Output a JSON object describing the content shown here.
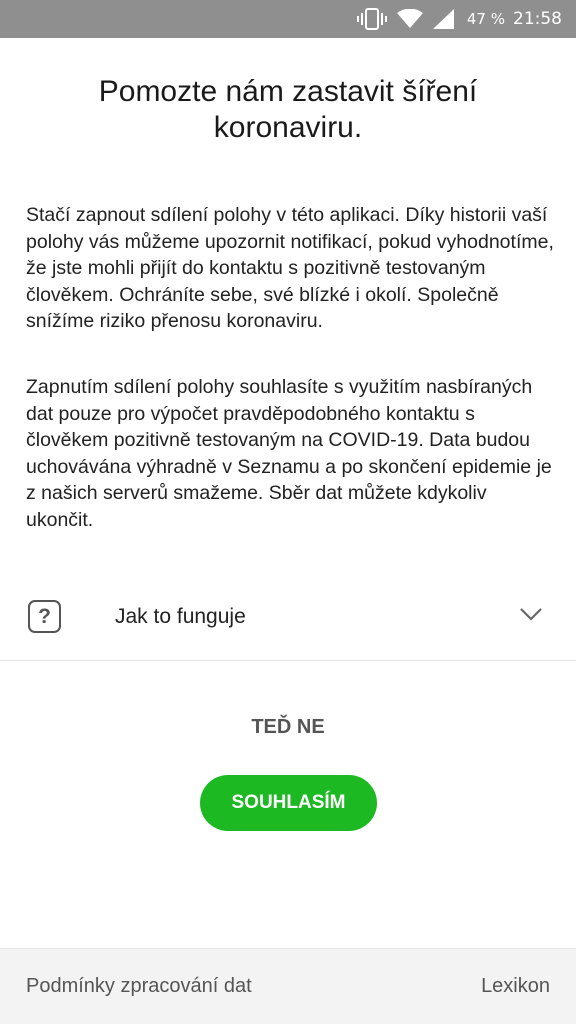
{
  "status_bar": {
    "battery": "47 %",
    "time": "21:58",
    "icons": [
      "vibrate-icon",
      "wifi-icon",
      "signal-icon"
    ]
  },
  "dialog": {
    "title": "Pomozte nám zastavit šíření\nkoronaviru.",
    "paragraph1": "Stačí zapnout sdílení polohy v této aplikaci. Díky historii vaší polohy vás můžeme upozornit notifikací, pokud vyhodnotíme, že jste mohli přijít do kontaktu s pozitivně testovaným člověkem. Ochráníte sebe, své blízké i okolí. Společně snížíme riziko přenosu koronaviru.",
    "paragraph2": "Zapnutím sdílení polohy souhlasíte s využitím nasbíraných dat pouze pro výpočet pravděpodobného kontaktu s člověkem pozitivně testovaným na COVID-19. Data budou uchovávána výhradně v Seznamu a po skončení epidemie je z našich serverů smažeme. Sběr dat můžete kdykoliv ukončit.",
    "howto": {
      "icon": "question-mark-icon",
      "label": "Jak to funguje",
      "chevron": "chevron-down-icon"
    },
    "not_now_label": "TEĎ NE",
    "agree_label": "SOUHLASÍM"
  },
  "footer": {
    "left_link": "Podmínky zpracování dat",
    "right_link": "Lexikon"
  },
  "colors": {
    "status_bar": "#8f8f8f",
    "accent_green": "#1db922",
    "footer_bg": "#f3f3f3"
  }
}
